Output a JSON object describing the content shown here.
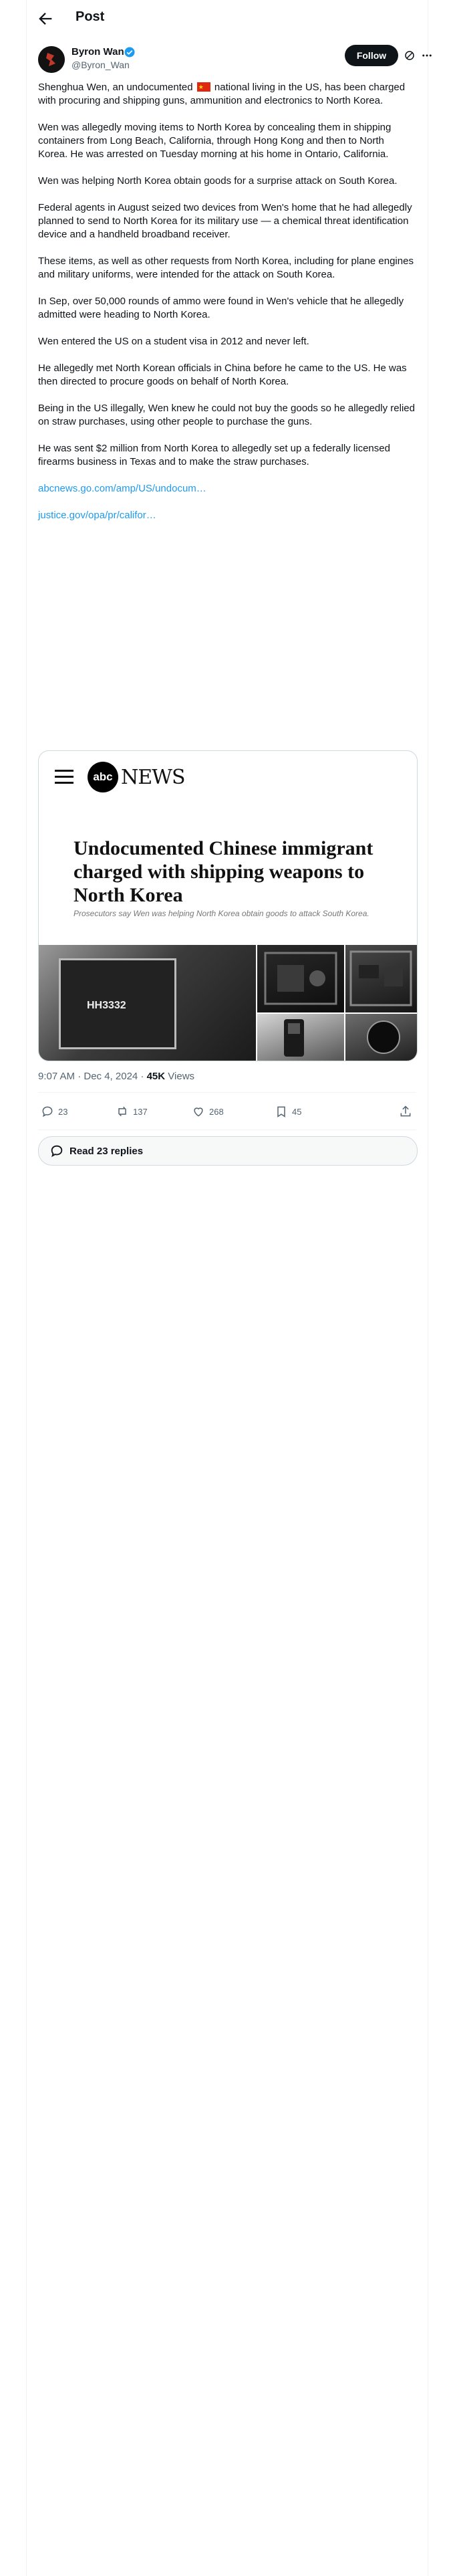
{
  "header": {
    "title": "Post"
  },
  "author": {
    "name": "Byron Wan",
    "handle": "@Byron_Wan",
    "follow_label": "Follow"
  },
  "paragraphs": {
    "p1_before_flag": "Shenghua Wen, an undocumented",
    "p1_after_flag": " national living in the US, has been charged with procuring and shipping guns, ammunition and electronics to North Korea.",
    "p2": "Wen was allegedly moving items to North Korea by concealing them in shipping containers from Long Beach, California, through Hong Kong and then to North Korea. He was arrested on Tuesday morning at his home in Ontario, California.",
    "p3": "Wen was helping North Korea obtain goods for a surprise attack on South Korea.",
    "p4": "Federal agents in August seized two devices from Wen's home that he had allegedly planned to send to North Korea for its military use — a chemical threat identification device and a handheld broadband receiver.",
    "p5": "These items, as well as other requests from North Korea, including for plane engines and military uniforms, were intended for the attack on South Korea.",
    "p6": "In Sep, over 50,000 rounds of ammo were found in Wen's vehicle that he allegedly admitted were heading to North Korea.",
    "p7": "Wen entered the US on a student visa in 2012 and never left.",
    "p8": "He allegedly met North Korean officials in China before he came to the US. He was then directed to procure goods on behalf of North Korea.",
    "p9": "Being in the US illegally, Wen knew he could not buy the goods so he allegedly relied on straw purchases, using other people to purchase the guns.",
    "p10": "He was sent $2 million from North Korea to allegedly set up a federally licensed firearms business in Texas and to make the straw purchases."
  },
  "links": [
    "abcnews.go.com/amp/US/undocum…",
    "justice.gov/opa/pr/califor…"
  ],
  "card": {
    "brand_logo": "abc",
    "brand_word": "NEWS",
    "title": "Undocumented Chinese immigrant charged with shipping weapons to North Korea",
    "subtitle": "Prosecutors say Wen was helping North Korea obtain goods to attack South Korea.",
    "photo_label": "HH3332"
  },
  "meta": {
    "time": "9:07 AM · Dec 4, 2024 · ",
    "views_count": "45K",
    "views_label": " Views"
  },
  "actions": {
    "replies": "23",
    "reposts": "137",
    "likes": "268",
    "bookmarks": "45"
  },
  "read_replies": "Read 23 replies",
  "icons": [
    "back-arrow-icon",
    "verified-badge-icon",
    "grok-icon",
    "more-icon",
    "reply-icon",
    "repost-icon",
    "like-icon",
    "bookmark-icon",
    "share-icon",
    "speech-bubble-icon"
  ],
  "colors": {
    "link": "#1d9bf0",
    "verified": "#1d9bf0",
    "text": "#0f1419",
    "muted": "#536471"
  }
}
